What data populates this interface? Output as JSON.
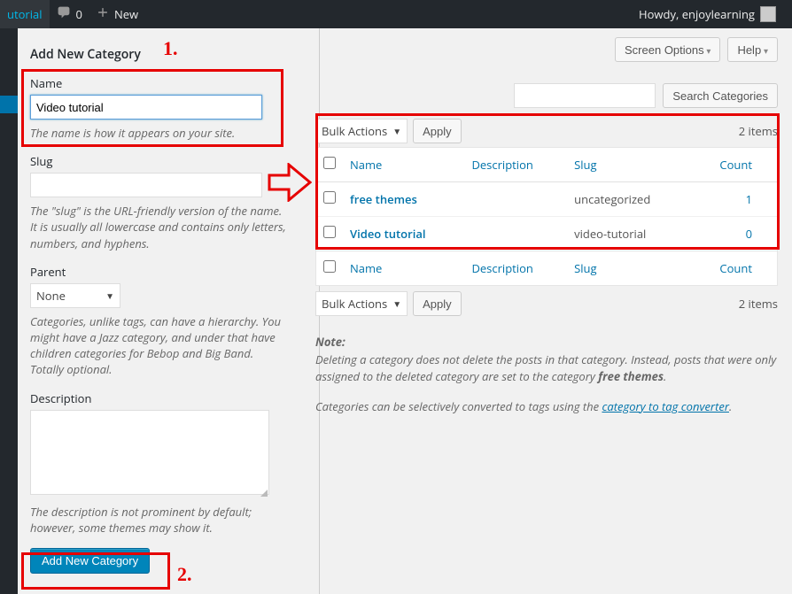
{
  "adminbar": {
    "site_label": "utorial",
    "comments_count": "0",
    "new_label": "New",
    "howdy": "Howdy, enjoylearning"
  },
  "screen_options": "Screen Options",
  "help": "Help",
  "search_button": "Search Categories",
  "form": {
    "title": "Add New Category",
    "name_label": "Name",
    "name_value": "Video tutorial",
    "name_help": "The name is how it appears on your site.",
    "slug_label": "Slug",
    "slug_value": "",
    "slug_help": "The \"slug\" is the URL-friendly version of the name. It is usually all lowercase and contains only letters, numbers, and hyphens.",
    "parent_label": "Parent",
    "parent_value": "None",
    "parent_help": "Categories, unlike tags, can have a hierarchy. You might have a Jazz category, and under that have children categories for Bebop and Big Band. Totally optional.",
    "description_label": "Description",
    "description_help": "The description is not prominent by default; however, some themes may show it.",
    "submit": "Add New Category"
  },
  "bulk": {
    "label": "Bulk Actions",
    "apply": "Apply"
  },
  "items_count": "2 items",
  "columns": {
    "name": "Name",
    "description": "Description",
    "slug": "Slug",
    "count": "Count"
  },
  "rows": [
    {
      "name": "free themes",
      "description": "",
      "slug": "uncategorized",
      "count": "1"
    },
    {
      "name": "Video tutorial",
      "description": "",
      "slug": "video-tutorial",
      "count": "0"
    }
  ],
  "note": {
    "heading": "Note:",
    "line1a": "Deleting a category does not delete the posts in that category. Instead, posts that were only assigned to the deleted category are set to the category ",
    "line1b": "free themes",
    "line1c": ".",
    "line2a": "Categories can be selectively converted to tags using the ",
    "link": "category to tag converter",
    "line2b": "."
  },
  "anno": {
    "n1": "1.",
    "n2": "2."
  }
}
